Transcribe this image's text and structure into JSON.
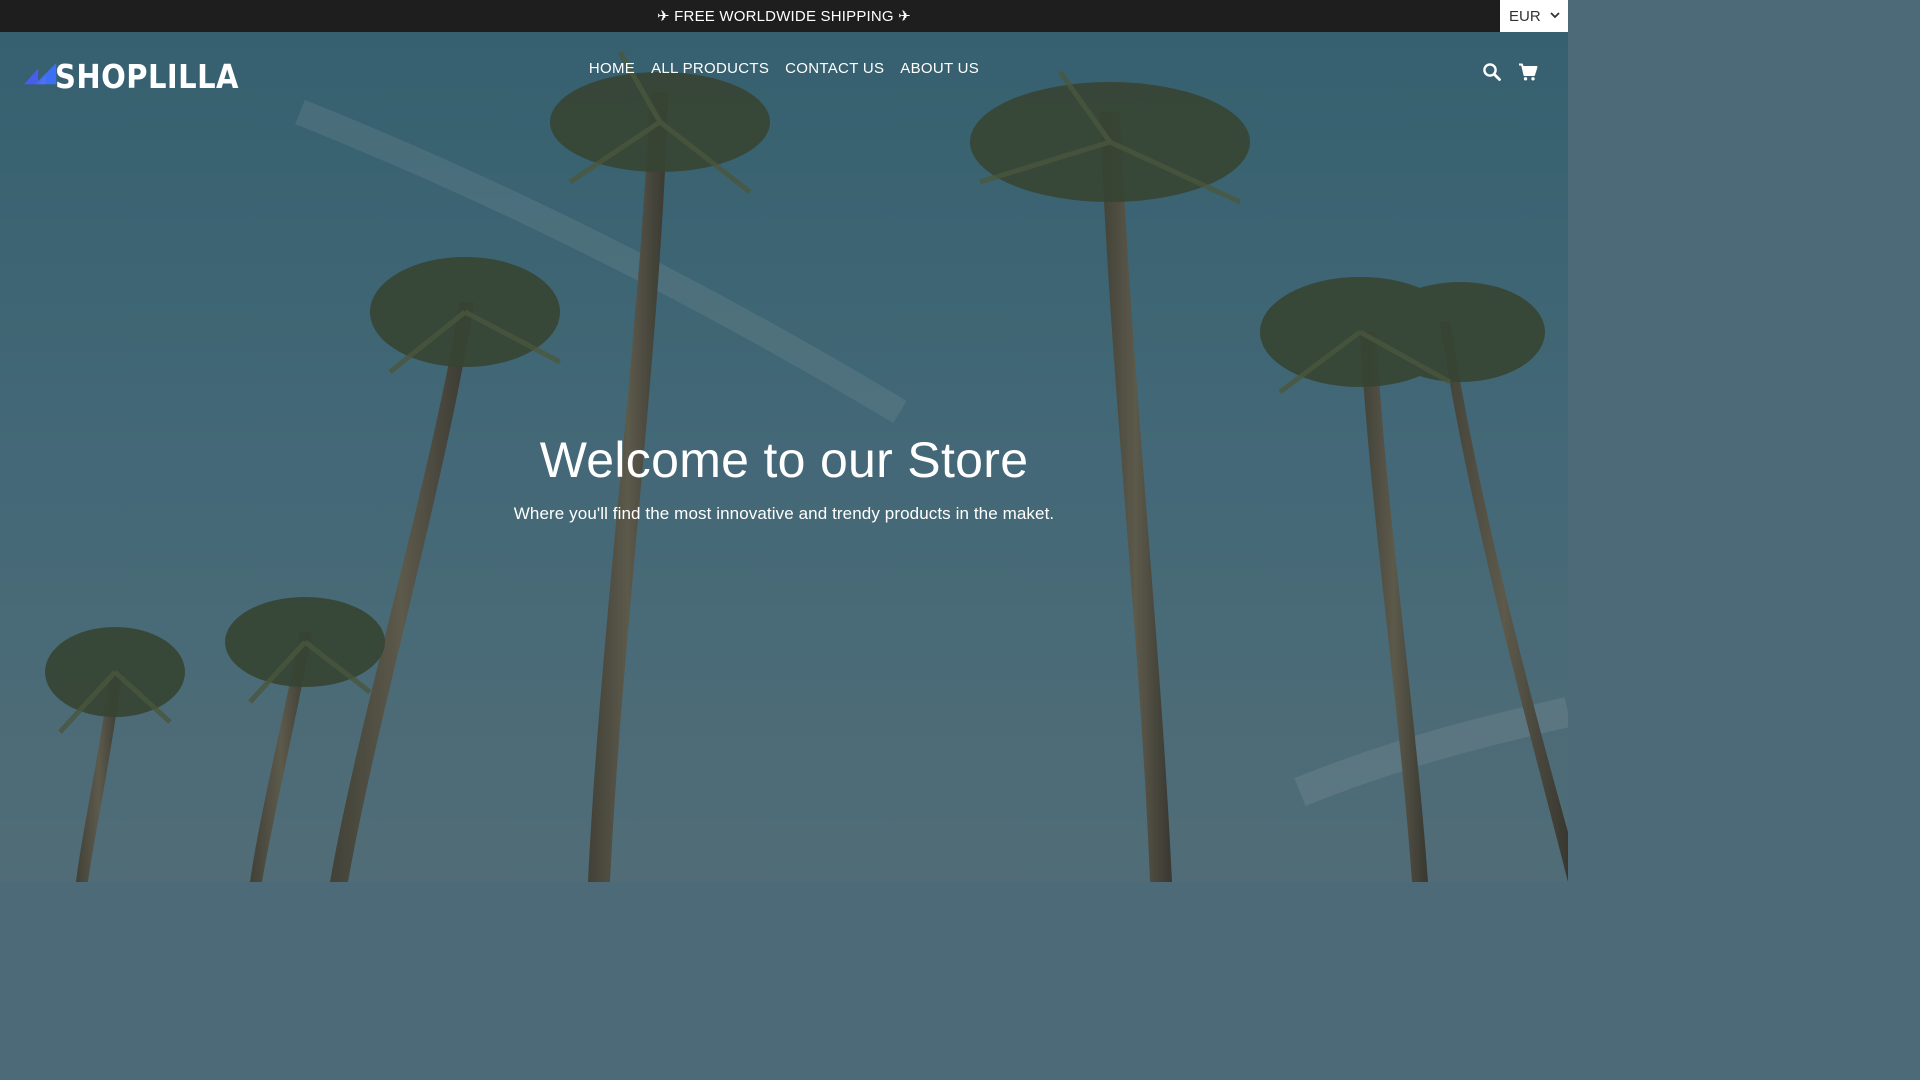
{
  "announcement": {
    "text": "✈ FREE WORLDWIDE SHIPPING ✈"
  },
  "currency": {
    "selected": "EUR",
    "icon": "chevron-down-icon"
  },
  "brand": {
    "name": "SHOPLILLA",
    "logo_colors": [
      "#4a5cf0",
      "#3b82f6"
    ]
  },
  "nav": {
    "items": [
      {
        "label": "HOME"
      },
      {
        "label": "ALL PRODUCTS"
      },
      {
        "label": "CONTACT US"
      },
      {
        "label": "ABOUT US"
      }
    ]
  },
  "header_icons": {
    "search": "search-icon",
    "cart": "cart-icon"
  },
  "hero": {
    "title": "Welcome to our Store",
    "subtitle": "Where you'll find the most innovative and trendy products in the maket."
  },
  "colors": {
    "announcement_bg": "#1e1e1e",
    "text": "#ffffff",
    "sky": "#4a7583"
  }
}
